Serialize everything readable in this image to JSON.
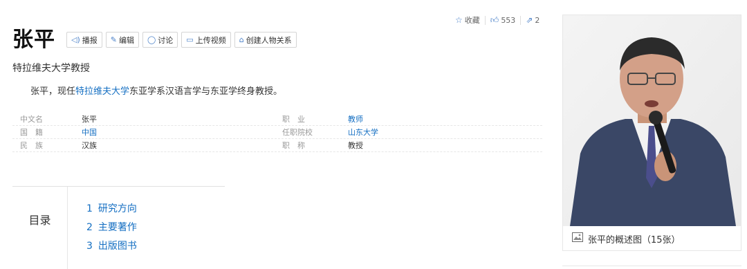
{
  "actions": {
    "favorite_label": "收藏",
    "like_count": "553",
    "share_count": "2"
  },
  "title": "张平",
  "toolbar": {
    "play": "播报",
    "edit": "编辑",
    "discuss": "讨论",
    "upload_video": "上传视频",
    "create_relation": "创建人物关系"
  },
  "subtitle": "特拉维夫大学教授",
  "summary": {
    "prefix": "张平，现任",
    "link": "特拉维夫大学",
    "suffix": "东亚学系汉语言学与东亚学终身教授。"
  },
  "info": [
    {
      "k1": "中文名",
      "v1": "张平",
      "k2": "职　业",
      "v2": "教师"
    },
    {
      "k1": "国　籍",
      "v1": "中国",
      "k2": "任职院校",
      "v2": "山东大学"
    },
    {
      "k1": "民　族",
      "v1": "汉族",
      "k2": "职　称",
      "v2": "教授"
    }
  ],
  "toc": {
    "label": "目录",
    "items": [
      {
        "num": "1",
        "text": "研究方向"
      },
      {
        "num": "2",
        "text": "主要著作"
      },
      {
        "num": "3",
        "text": "出版图书"
      }
    ]
  },
  "photo": {
    "caption": "张平的概述图（15张）"
  },
  "colors": {
    "link": "#136ec2",
    "accent_icon": "#4a80c8"
  }
}
